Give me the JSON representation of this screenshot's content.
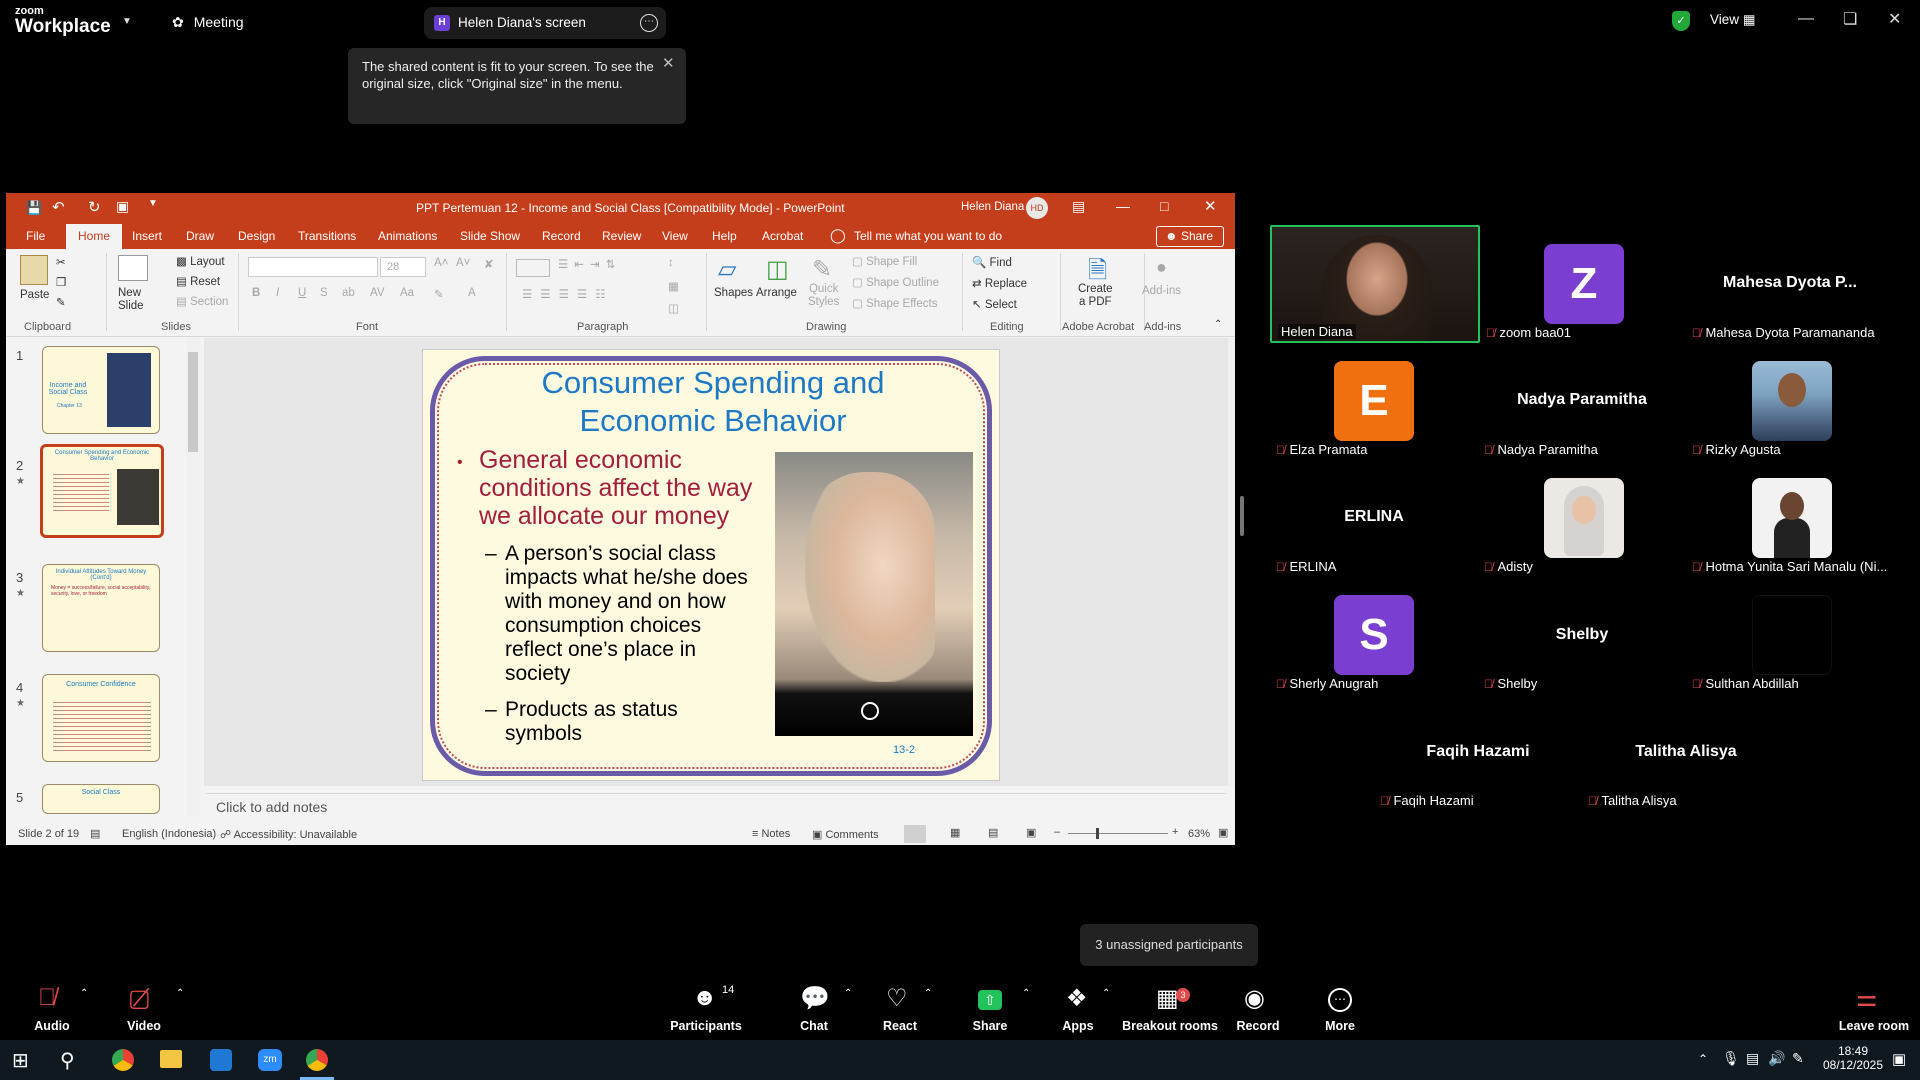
{
  "topbar": {
    "logo_line1": "zoom",
    "logo_line2": "Workplace",
    "meeting_label": "Meeting",
    "share_tab_initial": "H",
    "share_tab_label": "Helen Diana's screen",
    "view_label": "View",
    "tooltip_line1": "The shared content is fit to your screen. To see the",
    "tooltip_line2": "original size, click \"Original size\" in the menu."
  },
  "ppt": {
    "title": "PPT Pertemuan 12 - Income and Social Class [Compatibility Mode]  -  PowerPoint",
    "user": "Helen Diana",
    "user_initials": "HD",
    "tabs": [
      "File",
      "Home",
      "Insert",
      "Draw",
      "Design",
      "Transitions",
      "Animations",
      "Slide Show",
      "Record",
      "Review",
      "View",
      "Help",
      "Acrobat"
    ],
    "tell_me": "Tell me what you want to do",
    "share_btn": "Share",
    "ribbon": {
      "paste": "Paste",
      "clipboard": "Clipboard",
      "new_slide": "New\nSlide",
      "layout": "Layout",
      "reset": "Reset",
      "section": "Section",
      "slides": "Slides",
      "font_size": "28",
      "font": "Font",
      "paragraph": "Paragraph",
      "shapes": "Shapes",
      "arrange": "Arrange",
      "quick_styles": "Quick\nStyles",
      "shape_fill": "Shape Fill",
      "shape_outline": "Shape Outline",
      "shape_effects": "Shape Effects",
      "drawing": "Drawing",
      "find": "Find",
      "replace": "Replace",
      "select": "Select",
      "editing": "Editing",
      "create_pdf": "Create\na PDF",
      "adobe_acrobat": "Adobe Acrobat",
      "addins": "Add-ins",
      "addins_group": "Add-ins"
    },
    "thumbnails": [
      {
        "num": "1",
        "title": "Income and Social Class",
        "sub": "Chapter 13"
      },
      {
        "num": "2",
        "title": "Consumer Spending and Economic Behavior",
        "sub": ""
      },
      {
        "num": "3",
        "title": "Individual Attitudes Toward Money (Cont'd)",
        "sub": "Money = success/failure, social acceptability, security, love, or freedom"
      },
      {
        "num": "4",
        "title": "Consumer Confidence",
        "sub": ""
      },
      {
        "num": "5",
        "title": "Social Class",
        "sub": ""
      }
    ],
    "slide": {
      "title_line1": "Consumer Spending and",
      "title_line2": "Economic Behavior",
      "bullet_line1": "General economic",
      "bullet_line2": "conditions affect the way",
      "bullet_line3": "we allocate our money",
      "sub1_line1": "A person’s social class",
      "sub1_line2": "impacts what he/she does",
      "sub1_line3": "with money and on how",
      "sub1_line4": "consumption choices",
      "sub1_line5": "reflect one’s place in",
      "sub1_line6": "society",
      "sub2_line1": "Products as status",
      "sub2_line2": "symbols",
      "slide_number": "13-2"
    },
    "notes_placeholder": "Click to add notes",
    "status": {
      "slide_of": "Slide 2 of 19",
      "language": "English (Indonesia)",
      "accessibility": "Accessibility: Unavailable",
      "notes": "Notes",
      "comments": "Comments",
      "zoom": "63%"
    }
  },
  "gallery": {
    "tiles": [
      {
        "name": "Helen Diana",
        "big": "",
        "avatar": "video",
        "color": "",
        "muted": false
      },
      {
        "name": "zoom baa01",
        "big": "",
        "avatar": "Z",
        "color": "#7a3fd1",
        "muted": true
      },
      {
        "name": "Mahesa Dyota Paramananda",
        "big": "Mahesa Dyota P...",
        "avatar": "",
        "color": "",
        "muted": true
      },
      {
        "name": "Elza Pramata",
        "big": "",
        "avatar": "E",
        "color": "#f07010",
        "muted": true
      },
      {
        "name": "Nadya Paramitha",
        "big": "Nadya Paramitha",
        "avatar": "",
        "color": "",
        "muted": true
      },
      {
        "name": "Rizky Agusta",
        "big": "",
        "avatar": "photo",
        "color": "#7fa8c8",
        "muted": true
      },
      {
        "name": "ERLINA",
        "big": "ERLINA",
        "avatar": "",
        "color": "",
        "muted": true
      },
      {
        "name": "Adisty",
        "big": "",
        "avatar": "photo",
        "color": "#d8d0c8",
        "muted": true
      },
      {
        "name": "Hotma Yunita Sari Manalu (Ni...",
        "big": "",
        "avatar": "photo",
        "color": "#e0e0e0",
        "muted": true
      },
      {
        "name": "Sherly Anugrah",
        "big": "",
        "avatar": "S",
        "color": "#7a3fd1",
        "muted": true
      },
      {
        "name": "Shelby",
        "big": "Shelby",
        "avatar": "",
        "color": "",
        "muted": true
      },
      {
        "name": "Sulthan Abdillah",
        "big": "",
        "avatar": "black",
        "color": "#000000",
        "muted": true
      },
      {
        "name": "Faqih Hazami",
        "big": "Faqih Hazami",
        "avatar": "",
        "color": "",
        "muted": true
      },
      {
        "name": "Talitha Alisya",
        "big": "Talitha Alisya",
        "avatar": "",
        "color": "",
        "muted": true
      }
    ],
    "unassigned": "3 unassigned participants"
  },
  "toolbar": {
    "audio": "Audio",
    "video": "Video",
    "participants": "Participants",
    "participants_count": "14",
    "chat": "Chat",
    "react": "React",
    "share": "Share",
    "apps": "Apps",
    "breakout": "Breakout rooms",
    "breakout_badge": "3",
    "record": "Record",
    "more": "More",
    "leave": "Leave room"
  },
  "taskbar": {
    "time": "18:49",
    "date": "08/12/2025"
  }
}
